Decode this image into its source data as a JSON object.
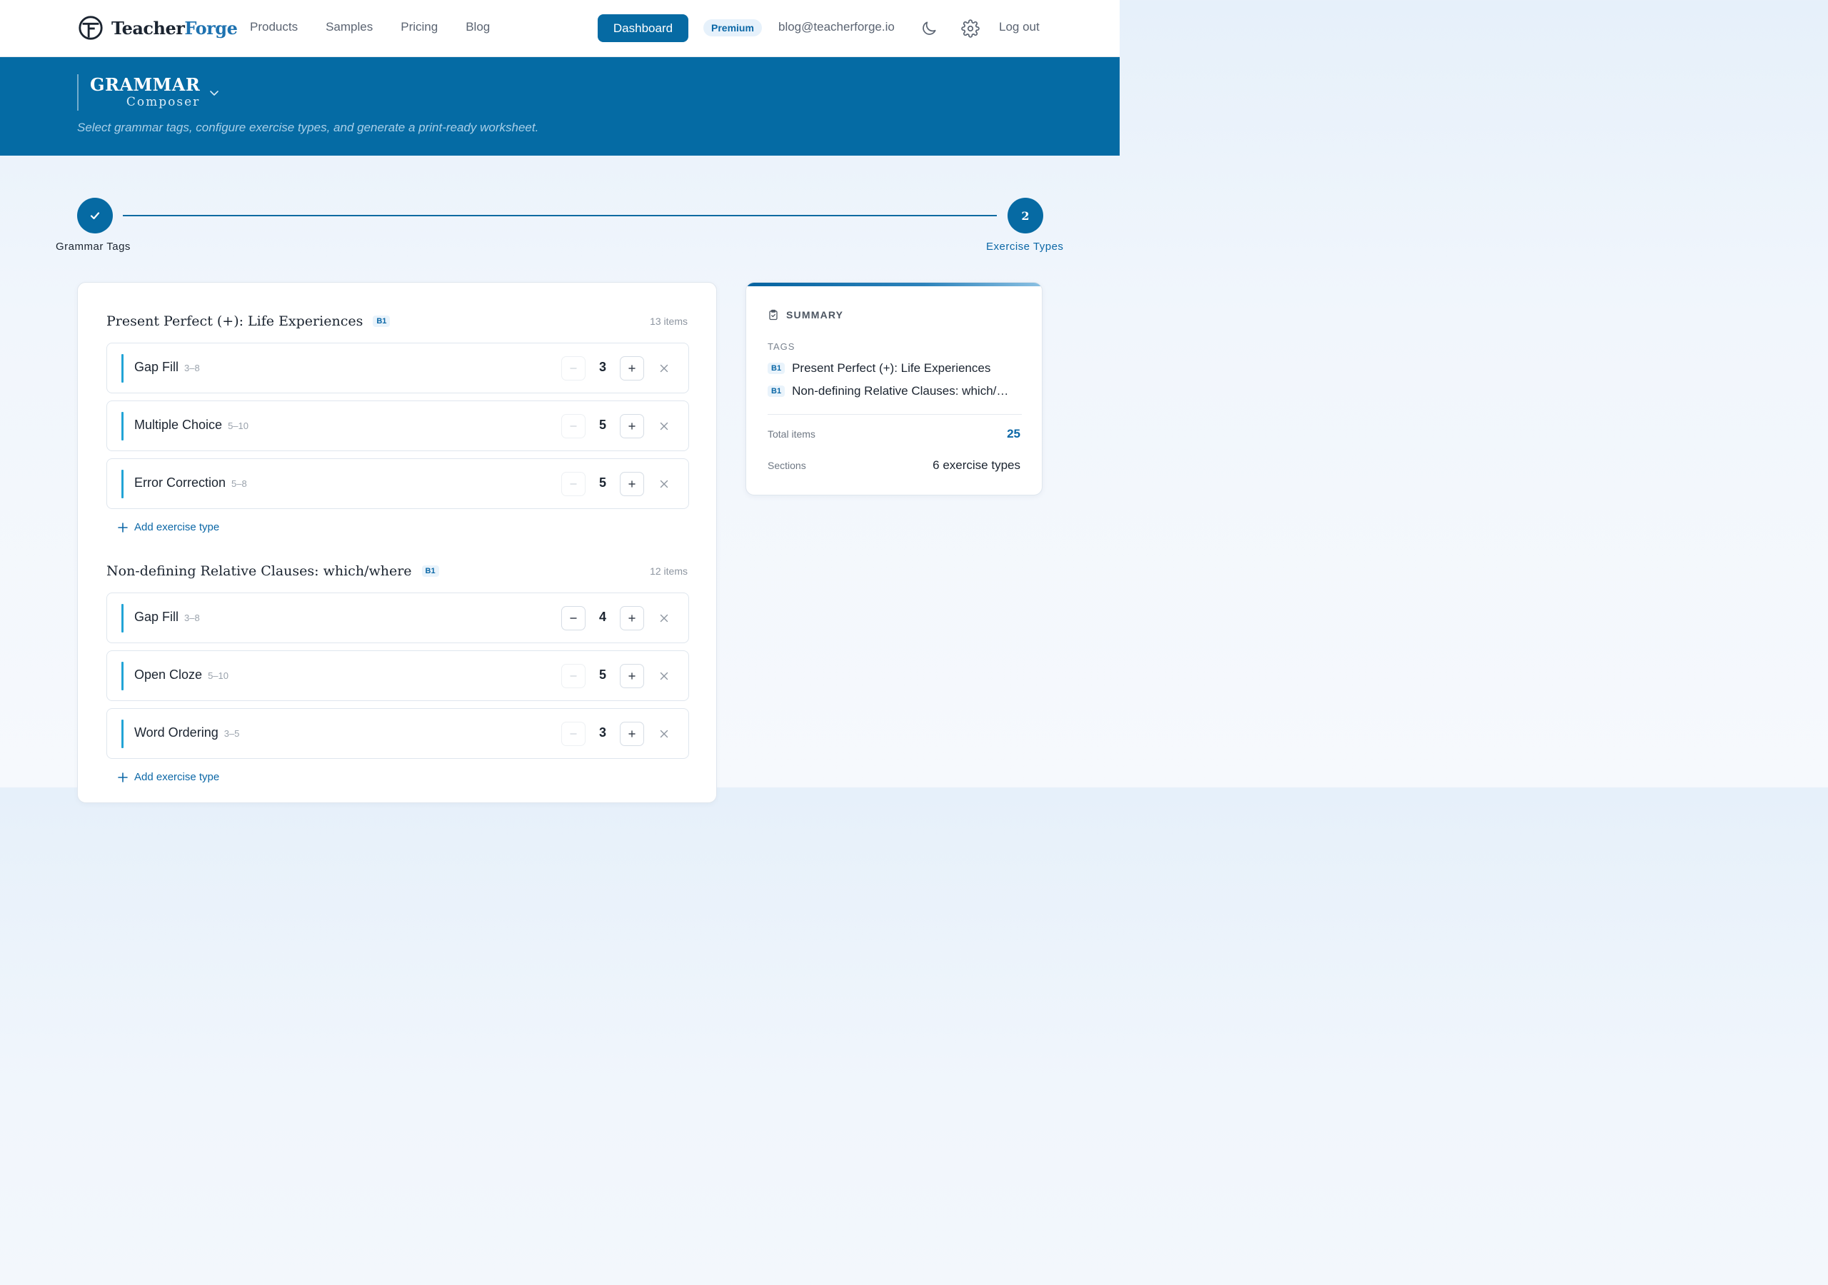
{
  "brand": {
    "name_part1": "Teacher",
    "name_part2": "Forge"
  },
  "nav": {
    "links": [
      "Products",
      "Samples",
      "Pricing",
      "Blog"
    ],
    "dashboard_label": "Dashboard",
    "plan_badge": "Premium",
    "user_email": "blog@teacherforge.io",
    "logout_label": "Log out",
    "icons": [
      "moon-icon",
      "gear-icon"
    ]
  },
  "hero": {
    "title": "GRAMMAR",
    "subtitle": "Composer",
    "description": "Select grammar tags, configure exercise types, and generate a print-ready worksheet."
  },
  "stepper": {
    "steps": [
      {
        "number": "1",
        "label": "Grammar Tags",
        "state": "completed"
      },
      {
        "number": "2",
        "label": "Exercise Types",
        "state": "active"
      }
    ]
  },
  "sections": [
    {
      "title": "Present Perfect (+): Life Experiences",
      "level": "B1",
      "count_label": "13 items",
      "exercises": [
        {
          "name": "Gap Fill",
          "range": "3–8",
          "qty": "3",
          "minus_disabled": true
        },
        {
          "name": "Multiple Choice",
          "range": "5–10",
          "qty": "5",
          "minus_disabled": true
        },
        {
          "name": "Error Correction",
          "range": "5–8",
          "qty": "5",
          "minus_disabled": true
        }
      ],
      "add_label": "Add exercise type"
    },
    {
      "title": "Non-defining Relative Clauses: which/where",
      "level": "B1",
      "count_label": "12 items",
      "exercises": [
        {
          "name": "Gap Fill",
          "range": "3–8",
          "qty": "4",
          "minus_disabled": false
        },
        {
          "name": "Open Cloze",
          "range": "5–10",
          "qty": "5",
          "minus_disabled": true
        },
        {
          "name": "Word Ordering",
          "range": "3–5",
          "qty": "3",
          "minus_disabled": true
        }
      ],
      "add_label": "Add exercise type"
    }
  ],
  "summary": {
    "heading": "SUMMARY",
    "tags_label": "TAGS",
    "tags": [
      {
        "level": "B1",
        "text": "Present Perfect (+): Life Experiences"
      },
      {
        "level": "B1",
        "text": "Non-defining Relative Clauses: which/where"
      }
    ],
    "total_label": "Total items",
    "total_value": "25",
    "sections_label": "Sections",
    "sections_value": "6 exercise types"
  },
  "colors": {
    "primary": "#066aa3",
    "hero_bg": "#056ba4",
    "accent_bar": "#22a4d6",
    "link": "#0b67a6"
  }
}
